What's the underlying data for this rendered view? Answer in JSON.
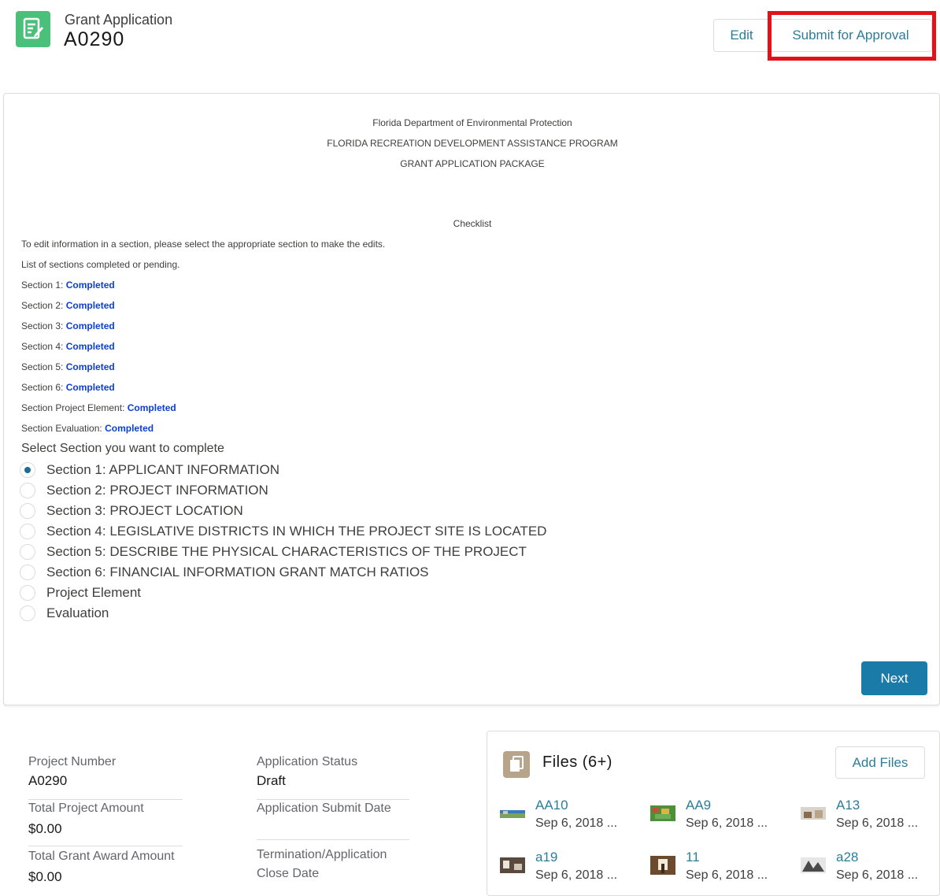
{
  "header": {
    "record_type": "Grant Application",
    "record_name": "A0290",
    "edit_label": "Edit",
    "submit_label": "Submit for Approval",
    "icon": "form-icon",
    "accent_color": "#4bc07a"
  },
  "document": {
    "line1": "Florida Department of Environmental Protection",
    "line2": "FLORIDA RECREATION DEVELOPMENT ASSISTANCE PROGRAM",
    "line3": "GRANT APPLICATION PACKAGE",
    "checklist_title": "Checklist",
    "instruction": "To edit information in a section, please select the appropriate section to make the edits.",
    "list_intro": "List of sections completed or pending.",
    "sections_status": [
      {
        "label": "Section 1:",
        "status": "Completed"
      },
      {
        "label": "Section 2:",
        "status": "Completed"
      },
      {
        "label": "Section 3:",
        "status": "Completed"
      },
      {
        "label": "Section 4:",
        "status": "Completed"
      },
      {
        "label": "Section 5:",
        "status": "Completed"
      },
      {
        "label": "Section 6:",
        "status": "Completed"
      },
      {
        "label": "Section Project Element:",
        "status": "Completed"
      },
      {
        "label": "Section Evaluation:",
        "status": "Completed"
      }
    ],
    "select_label": "Select Section you want to complete",
    "options": [
      "Section 1: APPLICANT INFORMATION",
      "Section 2: PROJECT INFORMATION",
      "Section 3: PROJECT LOCATION",
      "Section 4: LEGISLATIVE DISTRICTS IN WHICH THE PROJECT SITE IS LOCATED",
      "Section 5: DESCRIBE THE PHYSICAL CHARACTERISTICS OF THE PROJECT",
      "Section 6: FINANCIAL INFORMATION GRANT MATCH RATIOS",
      "Project Element",
      "Evaluation"
    ],
    "selected_option": "Section 1: APPLICANT INFORMATION",
    "next_label": "Next"
  },
  "fields": {
    "project_number_label": "Project Number",
    "project_number": "A0290",
    "application_status_label": "Application Status",
    "application_status": "Draft",
    "total_project_amount_label": "Total Project Amount",
    "total_project_amount": "$0.00",
    "submit_date_label": "Application Submit Date",
    "submit_date": "",
    "total_grant_award_label": "Total Grant Award Amount",
    "total_grant_award": "$0.00",
    "close_date_label_1": "Termination/Application",
    "close_date_label_2": "Close Date"
  },
  "files": {
    "title": "Files (6+)",
    "add_label": "Add Files",
    "items": [
      {
        "name": "AA10",
        "date": "Sep 6, 2018 ..."
      },
      {
        "name": "AA9",
        "date": "Sep 6, 2018 ..."
      },
      {
        "name": "A13",
        "date": "Sep 6, 2018 ..."
      },
      {
        "name": "a19",
        "date": "Sep 6, 2018 ..."
      },
      {
        "name": "11",
        "date": "Sep 6, 2018 ..."
      },
      {
        "name": "a28",
        "date": "Sep 6, 2018 ..."
      }
    ]
  }
}
